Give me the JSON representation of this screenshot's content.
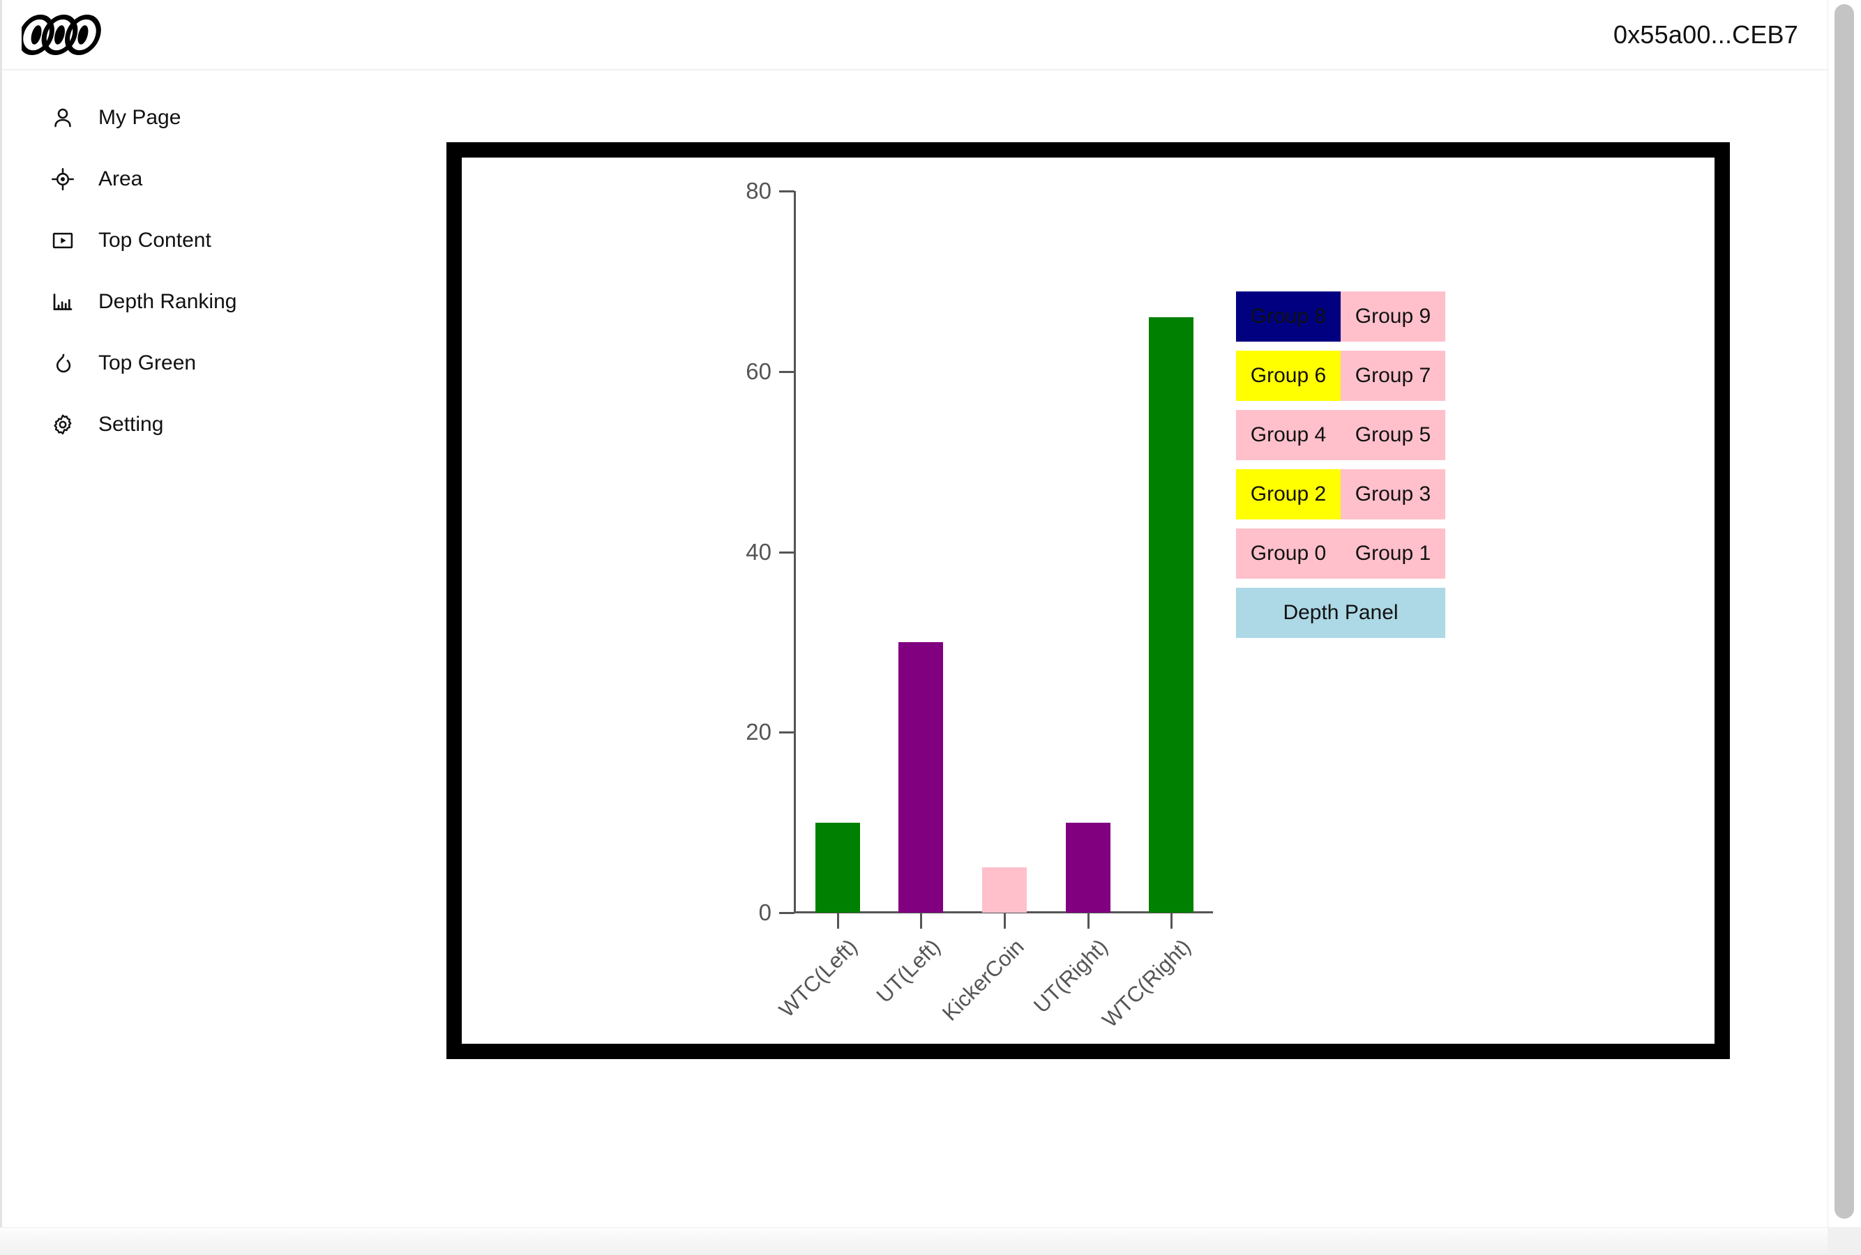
{
  "header": {
    "logo_text": "ODD",
    "logo_icon": "odd-logo",
    "wallet_address": "0x55a00...CEB7"
  },
  "sidebar": {
    "items": [
      {
        "label": "My Page",
        "icon": "user-icon"
      },
      {
        "label": "Area",
        "icon": "target-icon"
      },
      {
        "label": "Top Content",
        "icon": "play-square-icon"
      },
      {
        "label": "Depth Ranking",
        "icon": "bar-chart-icon"
      },
      {
        "label": "Top Green",
        "icon": "flame-icon"
      },
      {
        "label": "Setting",
        "icon": "gear-icon"
      }
    ]
  },
  "legend": {
    "rows": [
      [
        {
          "label": "Group 8",
          "bg": "#000080",
          "fg": "#111111"
        },
        {
          "label": "Group 9",
          "bg": "#FFC0CB",
          "fg": "#111111"
        }
      ],
      [
        {
          "label": "Group 6",
          "bg": "#FFFF00",
          "fg": "#111111"
        },
        {
          "label": "Group 7",
          "bg": "#FFC0CB",
          "fg": "#111111"
        }
      ],
      [
        {
          "label": "Group 4",
          "bg": "#FFC0CB",
          "fg": "#111111"
        },
        {
          "label": "Group 5",
          "bg": "#FFC0CB",
          "fg": "#111111"
        }
      ],
      [
        {
          "label": "Group 2",
          "bg": "#FFFF00",
          "fg": "#111111"
        },
        {
          "label": "Group 3",
          "bg": "#FFC0CB",
          "fg": "#111111"
        }
      ],
      [
        {
          "label": "Group 0",
          "bg": "#FFC0CB",
          "fg": "#111111"
        },
        {
          "label": "Group 1",
          "bg": "#FFC0CB",
          "fg": "#111111"
        }
      ]
    ],
    "depth_panel": {
      "label": "Depth Panel",
      "bg": "#ADD8E6",
      "fg": "#111111"
    }
  },
  "chart_data": {
    "type": "bar",
    "title": "",
    "xlabel": "",
    "ylabel": "",
    "categories": [
      "WTC(Left)",
      "UT(Left)",
      "KickerCoin",
      "UT(Right)",
      "WTC(Right)"
    ],
    "values": [
      10,
      30,
      5,
      10,
      66
    ],
    "colors": [
      "#008000",
      "#800080",
      "#FFC0CB",
      "#800080",
      "#008000"
    ],
    "ylim": [
      0,
      80
    ],
    "yticks": [
      0,
      20,
      40,
      60,
      80
    ],
    "ytick_labels": [
      "0",
      "20",
      "40",
      "60",
      "80"
    ],
    "grid": false,
    "legend_position": "right",
    "xtick_rotation": -45,
    "axis_color": "#555555",
    "frame_color": "#000000"
  }
}
